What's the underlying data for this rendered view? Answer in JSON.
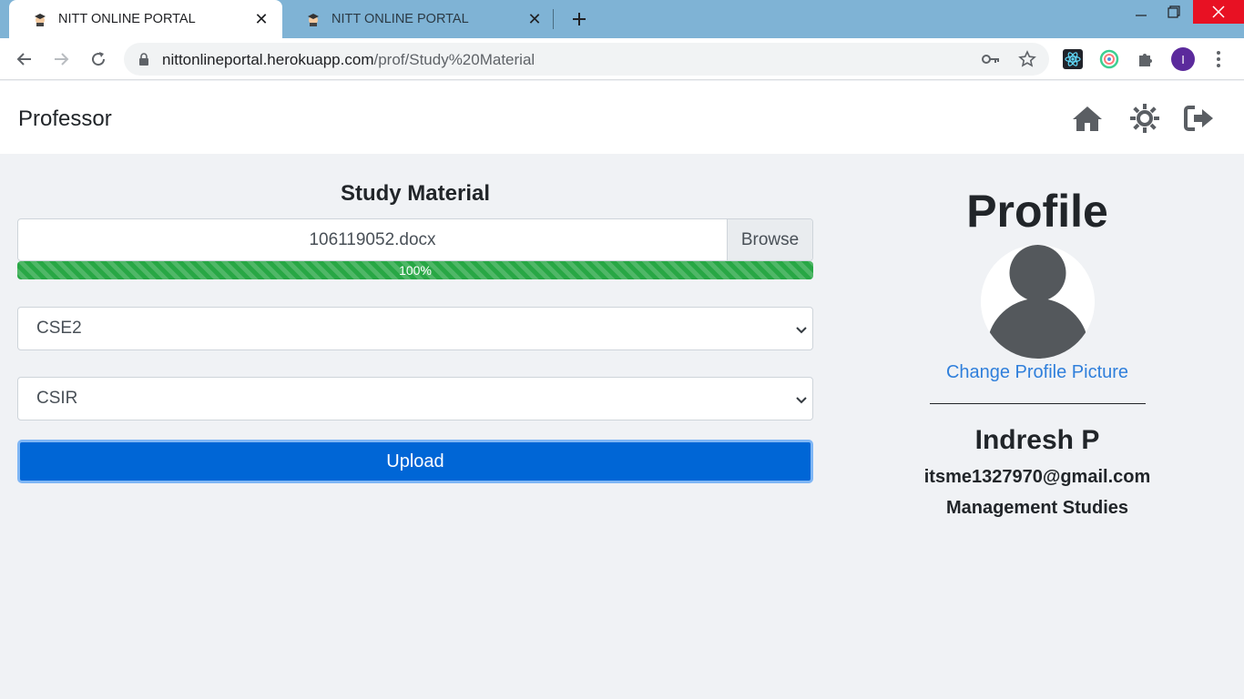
{
  "browser": {
    "tabs": [
      {
        "title": "NITT ONLINE PORTAL",
        "active": true
      },
      {
        "title": "NITT ONLINE PORTAL",
        "active": false
      }
    ],
    "url_host": "nittonlineportal.herokuapp.com",
    "url_path": "/prof/Study%20Material",
    "profile_initial": "I"
  },
  "navbar": {
    "brand": "Professor",
    "icons": [
      "home-icon",
      "settings-sun-icon",
      "logout-icon"
    ]
  },
  "study_material": {
    "title": "Study Material",
    "file_name": "106119052.docx",
    "browse_label": "Browse",
    "progress_percent": 100,
    "progress_label": "100%",
    "class_select_value": "CSE2",
    "category_select_value": "CSIR",
    "upload_label": "Upload"
  },
  "profile": {
    "title": "Profile",
    "change_picture_label": "Change Profile Picture",
    "name": "Indresh P",
    "email": "itsme1327970@gmail.com",
    "department": "Management Studies"
  },
  "colors": {
    "tabbar": "#7fb3d5",
    "progress": "#28a745",
    "upload_button": "#0066d6",
    "link": "#2f7fdb",
    "page_background": "#f0f2f5"
  }
}
